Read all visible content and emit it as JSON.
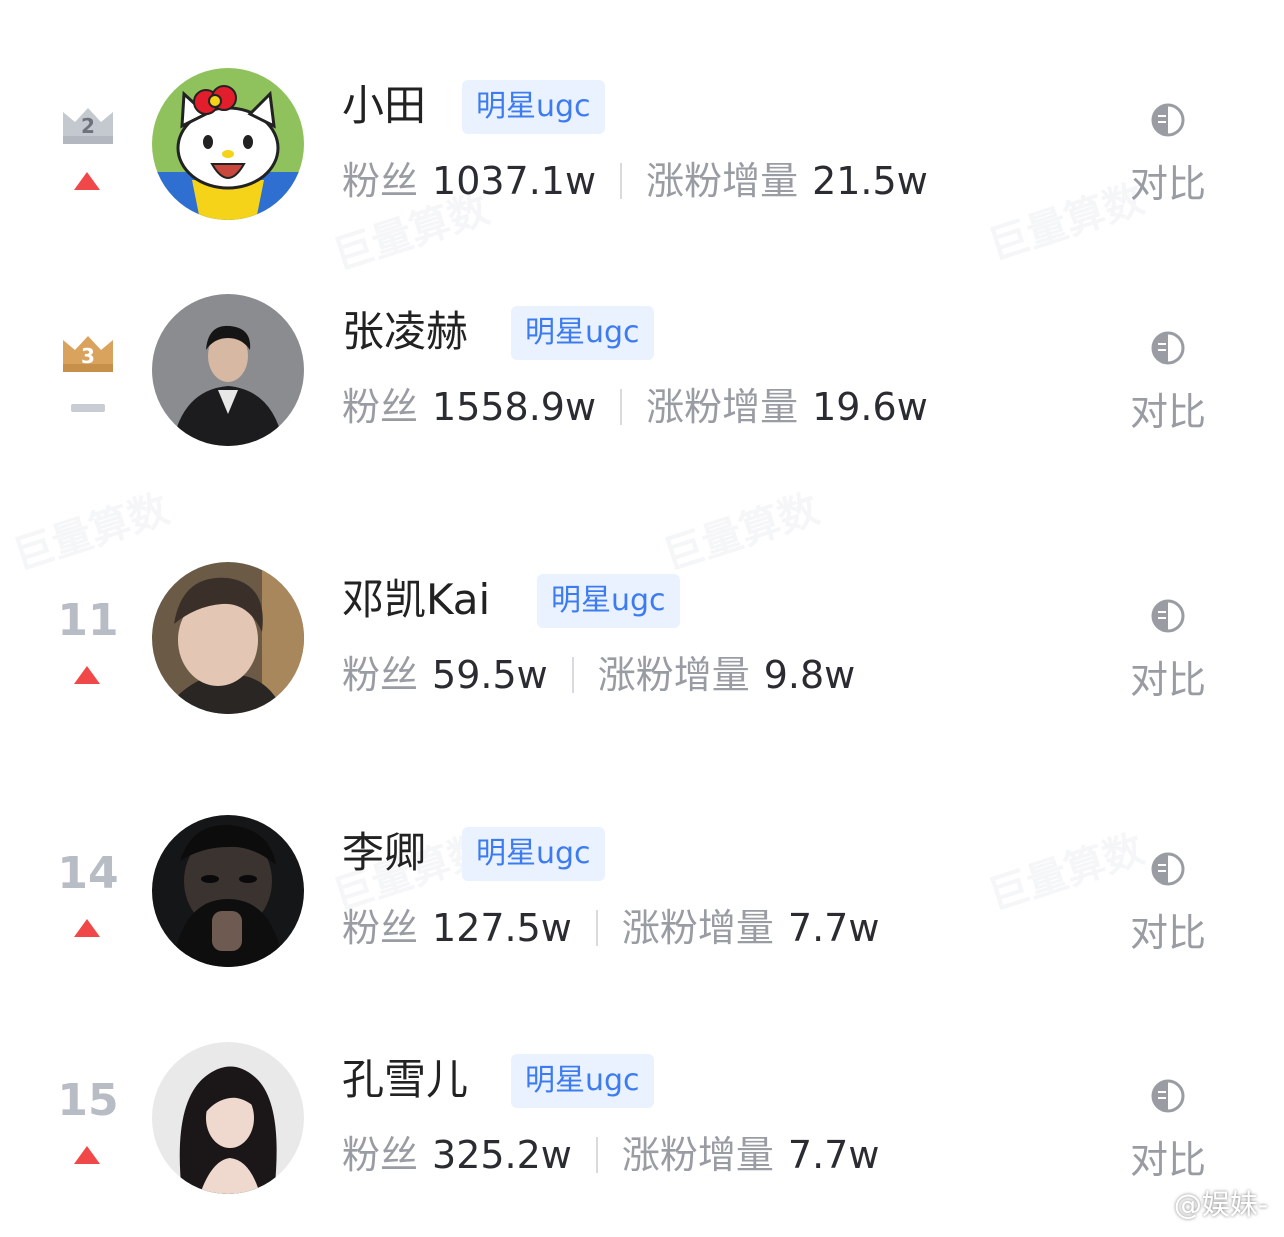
{
  "rows": [
    {
      "rank": "2",
      "rank_style": "crown-silver",
      "trend": "up",
      "name": "小田",
      "tag": "明星ugc",
      "fans_label": "粉丝",
      "fans_value": "1037.1w",
      "gain_label": "涨粉增量",
      "gain_value": "21.5w",
      "compare_label": "对比",
      "avatar_icon": "hello-kitty-avatar"
    },
    {
      "rank": "3",
      "rank_style": "crown-bronze",
      "trend": "flat",
      "name": "张凌赫",
      "tag": "明星ugc",
      "fans_label": "粉丝",
      "fans_value": "1558.9w",
      "gain_label": "涨粉增量",
      "gain_value": "19.6w",
      "compare_label": "对比",
      "avatar_icon": "person-avatar"
    },
    {
      "rank": "11",
      "rank_style": "number",
      "trend": "up",
      "name": "邓凯Kai",
      "tag": "明星ugc",
      "fans_label": "粉丝",
      "fans_value": "59.5w",
      "gain_label": "涨粉增量",
      "gain_value": "9.8w",
      "compare_label": "对比",
      "avatar_icon": "person-avatar"
    },
    {
      "rank": "14",
      "rank_style": "number",
      "trend": "up",
      "name": "李卿",
      "tag": "明星ugc",
      "fans_label": "粉丝",
      "fans_value": "127.5w",
      "gain_label": "涨粉增量",
      "gain_value": "7.7w",
      "compare_label": "对比",
      "avatar_icon": "person-avatar"
    },
    {
      "rank": "15",
      "rank_style": "number",
      "trend": "up",
      "name": "孔雪儿",
      "tag": "明星ugc",
      "fans_label": "粉丝",
      "fans_value": "325.2w",
      "gain_label": "涨粉增量",
      "gain_value": "7.7w",
      "compare_label": "对比",
      "avatar_icon": "person-avatar"
    }
  ],
  "watermark": "巨量算数",
  "weibo_credit": "@娱妹-",
  "colors": {
    "tag_bg": "#eaf2ff",
    "tag_text": "#3d7cf0",
    "trend_up": "#f04848",
    "muted": "#999ca3",
    "value": "#2a2c31",
    "crown_silver": "#c4c8cf",
    "crown_bronze": "#d9a35e"
  }
}
